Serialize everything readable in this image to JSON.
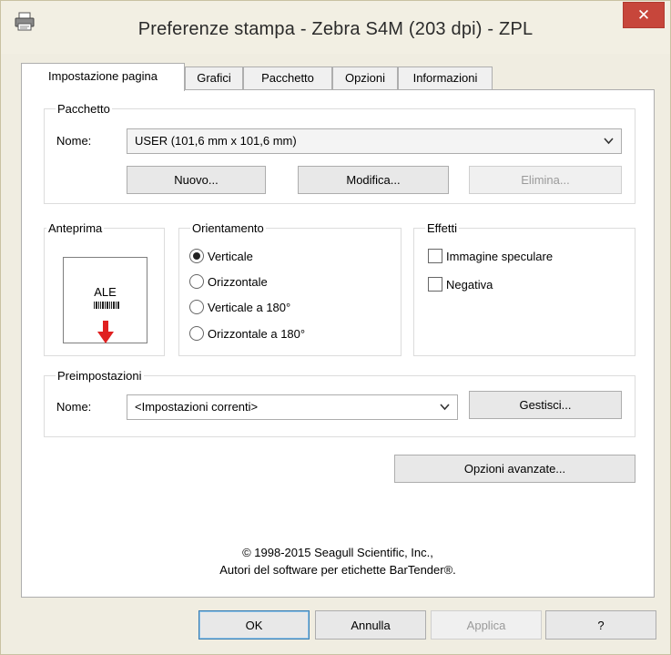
{
  "window": {
    "title": "Preferenze stampa - Zebra S4M (203 dpi) - ZPL",
    "close_label": "✕"
  },
  "tabs": [
    {
      "label": "Impostazione pagina",
      "active": true
    },
    {
      "label": "Grafici"
    },
    {
      "label": "Pacchetto"
    },
    {
      "label": "Opzioni"
    },
    {
      "label": "Informazioni"
    }
  ],
  "stock": {
    "legend": "Pacchetto",
    "name_label": "Nome:",
    "name_value": "USER (101,6 mm x 101,6 mm)",
    "new_label": "Nuovo...",
    "edit_label": "Modifica...",
    "delete_label": "Elimina..."
  },
  "preview": {
    "legend": "Anteprima",
    "sample_text": "ALE"
  },
  "orientation": {
    "legend": "Orientamento",
    "options": [
      {
        "label": "Verticale",
        "checked": true
      },
      {
        "label": "Orizzontale"
      },
      {
        "label": "Verticale a 180°"
      },
      {
        "label": "Orizzontale a 180°"
      }
    ]
  },
  "effects": {
    "legend": "Effetti",
    "mirror_label": "Immagine speculare",
    "negative_label": "Negativa"
  },
  "presets": {
    "legend": "Preimpostazioni",
    "name_label": "Nome:",
    "name_value": "<Impostazioni correnti>",
    "manage_label": "Gestisci..."
  },
  "advanced_label": "Opzioni avanzate...",
  "copyright": {
    "line1": "© 1998-2015 Seagull Scientific, Inc.,",
    "line2": "Autori del software per etichette BarTender®."
  },
  "footer": {
    "ok": "OK",
    "cancel": "Annulla",
    "apply": "Applica",
    "help": "?"
  },
  "colors": {
    "close_button": "#c7463b",
    "arrow": "#e02020"
  }
}
